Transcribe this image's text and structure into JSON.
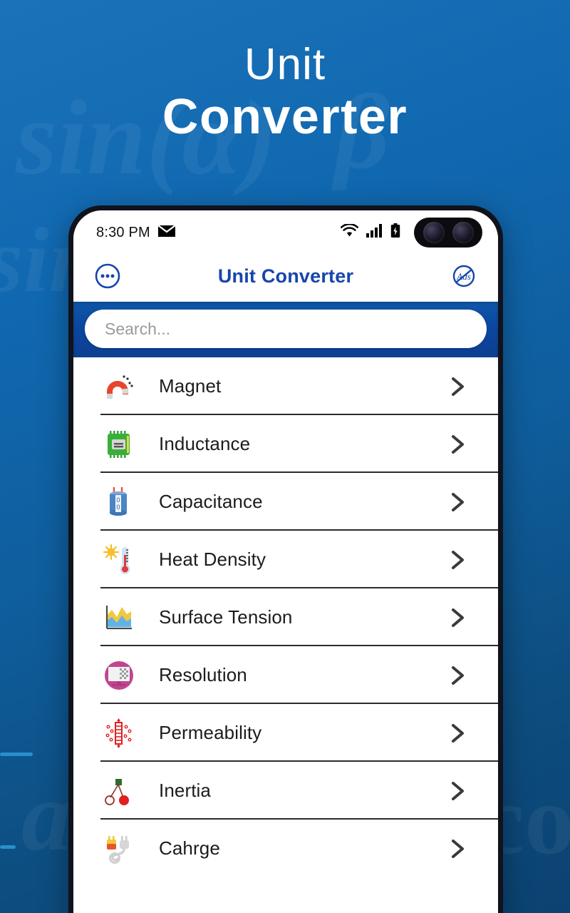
{
  "hero": {
    "line1": "Unit",
    "line2": "Converter"
  },
  "background": {
    "color_top": "#1b72b8",
    "color_bottom": "#0b4271",
    "accent_color": "#2e9ad6",
    "watermarks": [
      "sin",
      "sin",
      "a",
      "co",
      "β"
    ]
  },
  "phone": {
    "statusbar": {
      "time": "8:30 PM",
      "icons_left": [
        "envelope-icon"
      ],
      "icons_right": [
        "wifi-icon",
        "signal-icon",
        "battery-charging-icon"
      ],
      "camera": "dual-punch-hole-camera"
    },
    "appbar": {
      "menu_icon": "more-options-circle-icon",
      "title": "Unit Converter",
      "title_color": "#1646ac",
      "right_icon": "no-ads-icon"
    },
    "search": {
      "placeholder": "Search...",
      "value": "",
      "band_color": "#0b47a0"
    },
    "list": {
      "items": [
        {
          "label": "Magnet",
          "icon": "magnet-icon",
          "chevron": "chevron-right-icon"
        },
        {
          "label": "Inductance",
          "icon": "chip-icon",
          "chevron": "chevron-right-icon"
        },
        {
          "label": "Capacitance",
          "icon": "capacitor-icon",
          "chevron": "chevron-right-icon"
        },
        {
          "label": "Heat Density",
          "icon": "thermometer-sun-icon",
          "chevron": "chevron-right-icon"
        },
        {
          "label": "Surface Tension",
          "icon": "area-chart-icon",
          "chevron": "chevron-right-icon"
        },
        {
          "label": "Resolution",
          "icon": "monitor-pixels-icon",
          "chevron": "chevron-right-icon"
        },
        {
          "label": "Permeability",
          "icon": "permeability-tube-icon",
          "chevron": "chevron-right-icon"
        },
        {
          "label": "Inertia",
          "icon": "pendulum-icon",
          "chevron": "chevron-right-icon"
        },
        {
          "label": "Cahrge",
          "icon": "power-plug-icon",
          "chevron": "chevron-right-icon"
        }
      ]
    }
  }
}
